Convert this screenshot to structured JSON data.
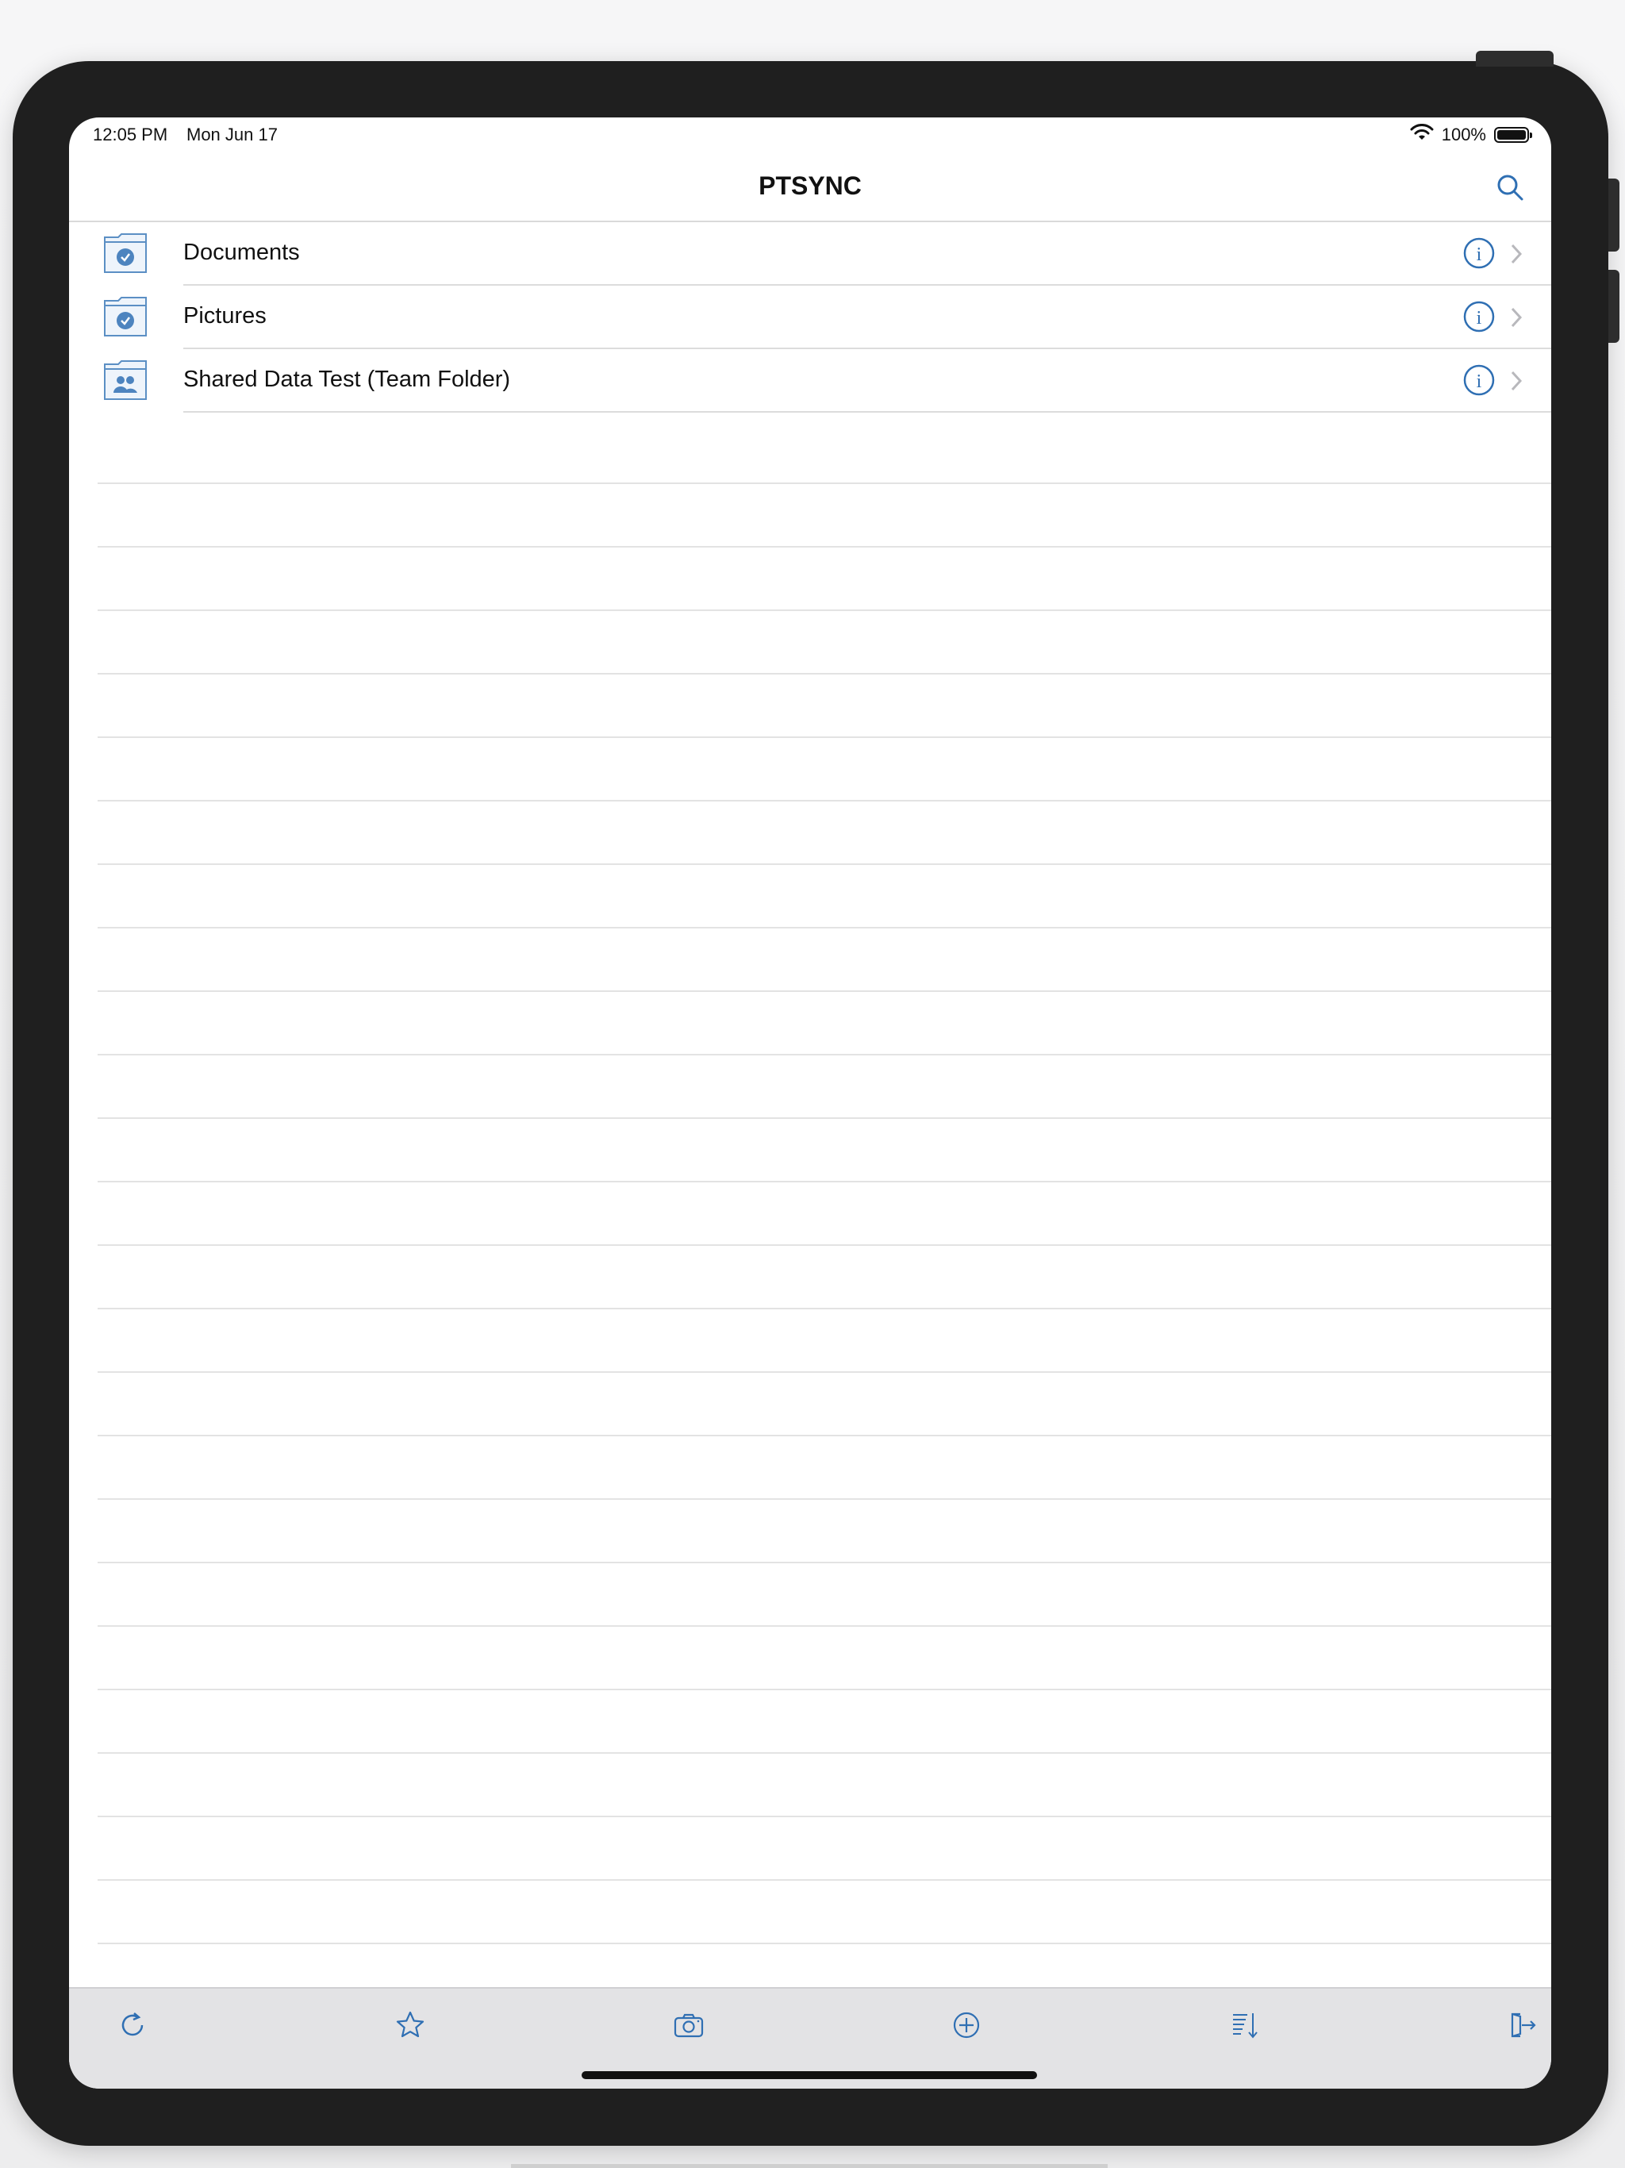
{
  "status": {
    "time": "12:05 PM",
    "date": "Mon Jun 17",
    "battery": "100%"
  },
  "nav": {
    "title": "PTSYNC"
  },
  "items": [
    {
      "label": "Documents",
      "icon": "sync-folder-icon"
    },
    {
      "label": "Pictures",
      "icon": "sync-folder-icon"
    },
    {
      "label": "Shared Data Test (Team Folder)",
      "icon": "team-folder-icon"
    }
  ],
  "toolbar": {
    "buttons": [
      "refresh-icon",
      "star-icon",
      "camera-icon",
      "add-icon",
      "sort-icon",
      "logout-icon"
    ]
  },
  "colors": {
    "accent": "#2f6fb3",
    "folder": "#5b8fc4"
  }
}
